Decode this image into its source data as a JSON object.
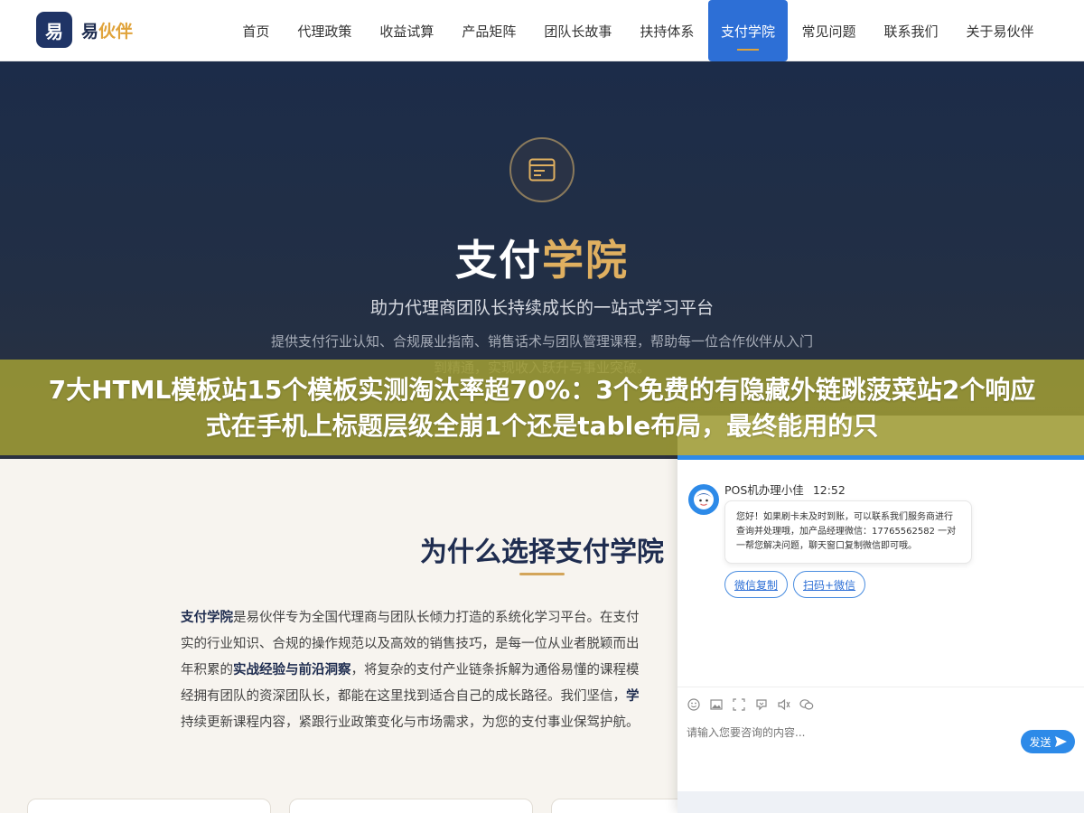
{
  "header": {
    "logo_char": "易",
    "logo_name_main": "易",
    "logo_name_accent": "伙伴",
    "nav": [
      {
        "label": "首页"
      },
      {
        "label": "代理政策"
      },
      {
        "label": "收益试算"
      },
      {
        "label": "产品矩阵"
      },
      {
        "label": "团队长故事"
      },
      {
        "label": "扶持体系"
      },
      {
        "label": "支付学院",
        "active": true
      },
      {
        "label": "常见问题"
      },
      {
        "label": "联系我们"
      },
      {
        "label": "关于易伙伴"
      }
    ]
  },
  "hero": {
    "title_main": "支付",
    "title_accent": "学院",
    "subtitle": "助力代理商团队长持续成长的一站式学习平台",
    "desc": "提供支付行业认知、合规展业指南、销售话术与团队管理课程，帮助每一位合作伙伴从入门到精通，实现收入跃升与事业突破。"
  },
  "banner": {
    "text": "7大HTML模板站15个模板实测淘汰率超70%：3个免费的有隐藏外链跳菠菜站2个响应式在手机上标题层级全崩1个还是table布局，最终能用的只"
  },
  "why": {
    "title": "为什么选择支付学院",
    "l1_b": "支付学院",
    "l1": "是易伙伴专为全国代理商与团队长倾力打造的系统化学习平台。在支付",
    "l2": "实的行业知识、合规的操作规范以及高效的销售技巧，是每一位从业者脱颖而出",
    "l3_a": "年积累的",
    "l3_b": "实战经验与前沿洞察",
    "l3_c": "，将复杂的支付产业链条拆解为通俗易懂的课程模",
    "l4_a": "经拥有团队的资深团队长，都能在这里找到适合自己的成长路径。我们坚信，",
    "l4_b": "学",
    "l5": "持续更新课程内容，紧跟行业政策变化与市场需求，为您的支付事业保驾护航。"
  },
  "chat": {
    "agent_name": "POS机办理小佳",
    "time": "12:52",
    "message": "您好！如果刷卡未及时到账，可以联系我们服务商进行查询并处理哦，加产品经理微信：17765562582 一对一帮您解决问题，聊天窗口复制微信即可哦。",
    "quick_1": "微信复制",
    "quick_2": "扫码+微信",
    "input_placeholder": "请输入您要咨询的内容...",
    "send_label": "发送"
  }
}
